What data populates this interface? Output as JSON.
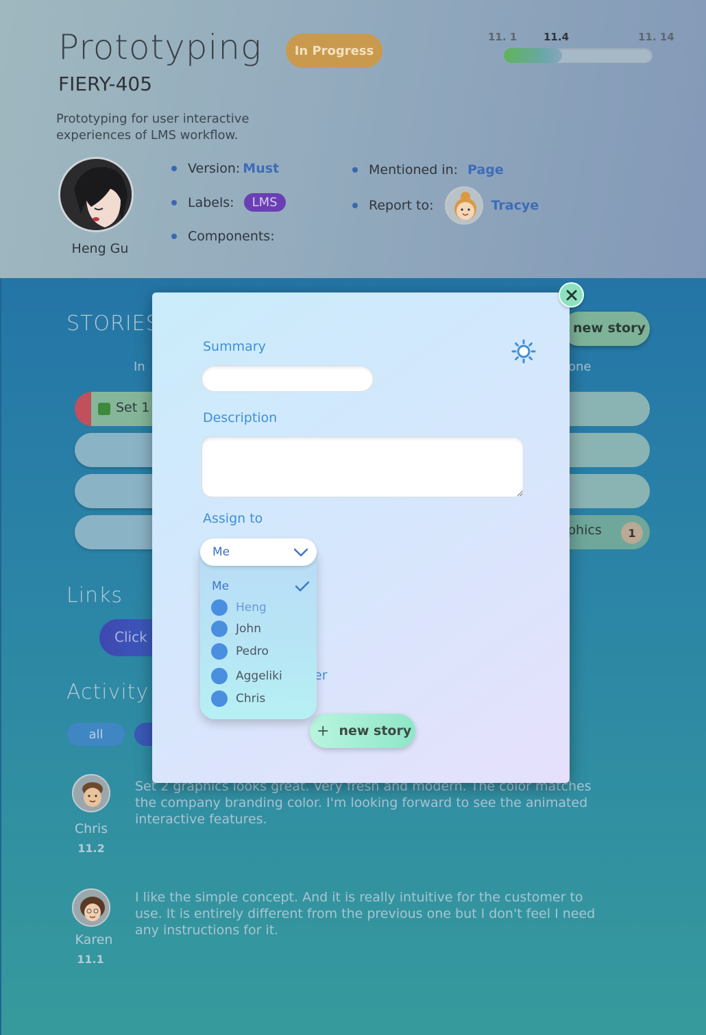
{
  "header": {
    "title": "Prototyping",
    "ticket_id": "FIERY-405",
    "status": "In Progress",
    "description": "Prototyping for user interactive experiences of LMS workflow.",
    "owner": "Heng Gu",
    "progress": {
      "start_label": "11. 1",
      "current_label": "11.4",
      "end_label": "11. 14",
      "fraction": 0.39
    },
    "meta": {
      "version_label": "Version:",
      "version_value": "Must",
      "labels_label": "Labels:",
      "labels_value": "LMS",
      "components_label": "Components:",
      "mentioned_label": "Mentioned in:",
      "mentioned_value": "Page",
      "report_label": "Report to:",
      "report_value": "Tracye"
    }
  },
  "main": {
    "stories_title": "STORIES",
    "col_left": "In",
    "col_right": "one",
    "story_chip": "Set 1",
    "graphics_fragment": "phics",
    "graphics_count": "1",
    "new_story_top": "new story",
    "links_title": "Links",
    "click_button": "Click",
    "activity_title": "Activity",
    "filter_all": "all",
    "activity": [
      {
        "name": "Chris",
        "date": "11.2",
        "text": "Set 2 graphics looks great. Very fresh and modern. The color matches the company branding color. I'm looking forward to see the animated interactive features."
      },
      {
        "name": "Karen",
        "date": "11.1",
        "text": "I like the simple concept. And it is really intuitive for the customer to use. It is entirely different from the previous one but I don't feel I need any instructions for it."
      }
    ]
  },
  "modal": {
    "summary_label": "Summary",
    "description_label": "Description",
    "assign_label": "Assign to",
    "assign_value": "Me",
    "dropdown_selected": "Me",
    "dropdown_options": [
      "Heng",
      "John",
      "Pedro",
      "Aggeliki",
      "Chris"
    ],
    "mention_fragment": "er",
    "new_story_button": "new story",
    "settings_icon": "sun-gear-icon",
    "close_icon": "close-icon"
  },
  "colors": {
    "accent_blue": "#3f8fd6",
    "status_orange": "#c99a4e",
    "label_purple": "#6a3fb5",
    "mint": "#8fe0bf"
  }
}
